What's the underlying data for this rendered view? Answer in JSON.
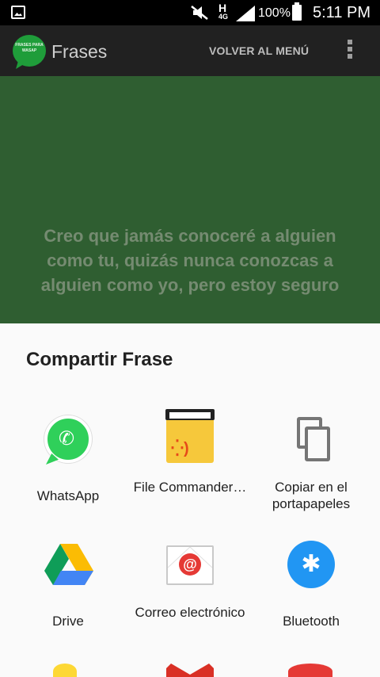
{
  "status_bar": {
    "network_label": "H",
    "network_sub": "4G",
    "battery_percent": "100%",
    "time": "5:11 PM",
    "icons": [
      "gallery-icon",
      "mute-icon",
      "signal-icon",
      "battery-icon"
    ]
  },
  "app_bar": {
    "logo_text": "FRASES PARA WASAP",
    "title": "Frases",
    "back_to_menu": "VOLVER AL MENÚ",
    "overflow_icon": "overflow-menu-icon"
  },
  "quote": {
    "text": "Creo que jamás conoceré a alguien como tu, quizás nunca conozcas a alguien como yo, pero estoy seguro"
  },
  "share_sheet": {
    "title": "Compartir Frase",
    "apps": [
      {
        "label": "WhatsApp",
        "icon": "whatsapp-icon"
      },
      {
        "label": "File Commander…",
        "icon": "file-commander-icon"
      },
      {
        "label": "Copiar en el portapapeles",
        "icon": "copy-icon"
      },
      {
        "label": "Drive",
        "icon": "drive-icon"
      },
      {
        "label": "Correo electrónico",
        "icon": "email-icon"
      },
      {
        "label": "Bluetooth",
        "icon": "bluetooth-icon"
      }
    ]
  },
  "colors": {
    "app_bar": "#212121",
    "content_bg": "#2f5e31",
    "quote_text": "#758b71",
    "sheet_bg": "#fafafa",
    "whatsapp": "#2fd05a",
    "bluetooth": "#2196f3",
    "email": "#e53935"
  }
}
